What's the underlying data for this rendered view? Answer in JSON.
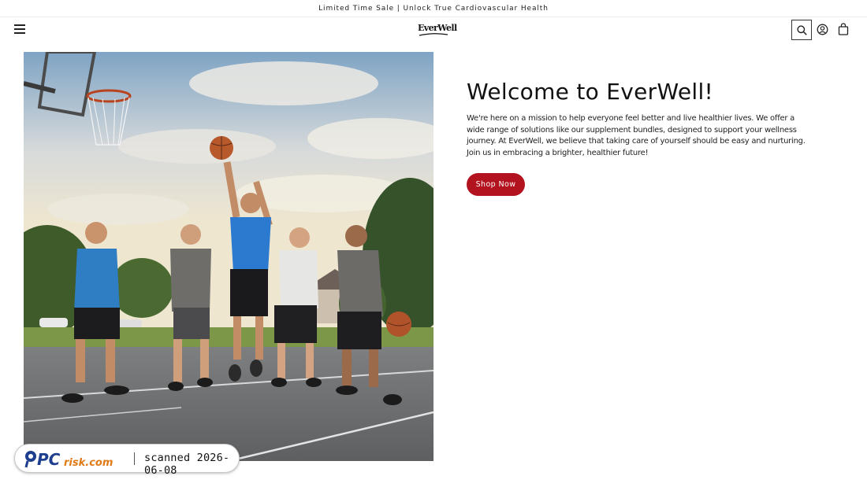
{
  "announcement": {
    "text": "Limited Time Sale | Unlock True Cardiovascular Health"
  },
  "header": {
    "brand_logo_text": "EverWell",
    "menu_icon": "hamburger-menu-icon",
    "search_icon": "search-icon",
    "account_icon": "account-icon",
    "cart_icon": "shopping-bag-icon"
  },
  "hero": {
    "image_icon": "basketball-players-photo",
    "title": "Welcome to EverWell!",
    "body": "We're here on a mission to help everyone feel better and live healthier lives. We offer a wide range of solutions like our supplement bundles, designed to support your wellness journey. At EverWell, we believe that taking care of yourself should be easy and nurturing. Join us in embracing a brighter, healthier future!",
    "cta_label": "Shop Now"
  },
  "watermark": {
    "logo_text": "PCrisk.com",
    "text": "scanned 2026-06-08"
  },
  "colors": {
    "accent": "#b3121f",
    "text": "#111111",
    "background": "#ffffff"
  }
}
